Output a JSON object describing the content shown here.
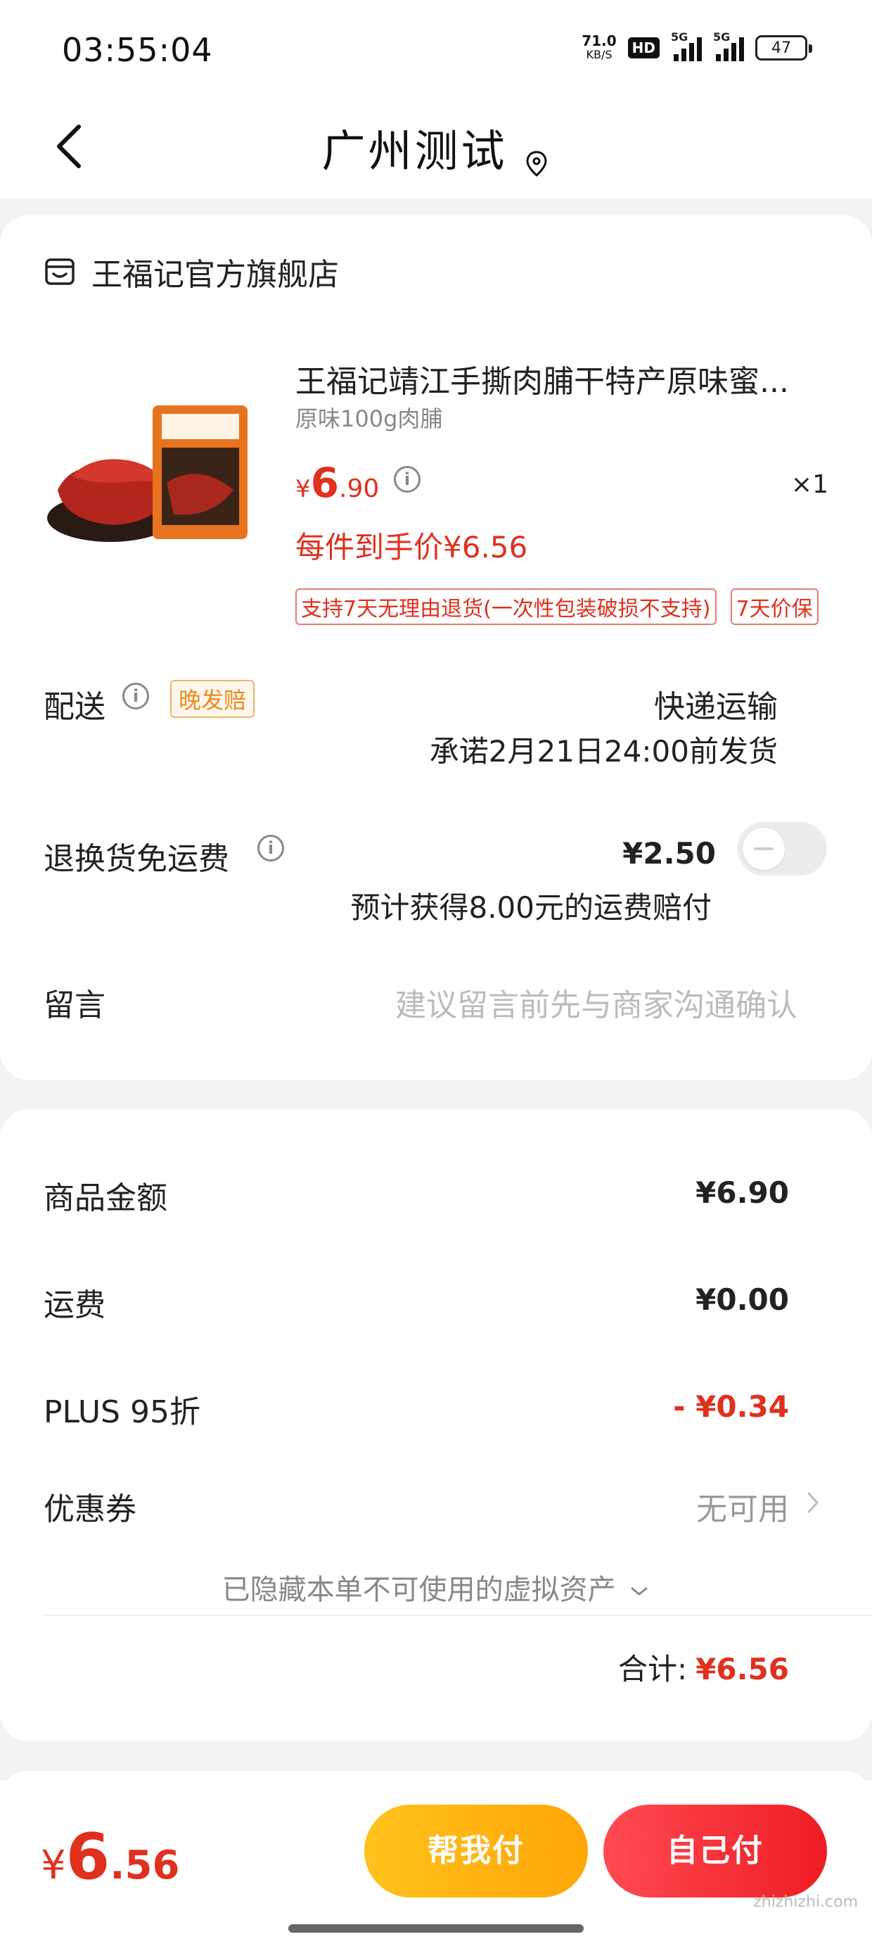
{
  "status_bar": {
    "time": "03:55:04",
    "net_speed_value": "71.0",
    "net_speed_unit": "KB/S",
    "hd_label": "HD",
    "signal1_label": "5G",
    "signal2_label": "5G",
    "battery": "47"
  },
  "header": {
    "title": "广州测试",
    "back_icon": "chevron-left-icon",
    "location_icon": "location-pin-icon"
  },
  "store": {
    "name": "王福记官方旗舰店",
    "icon": "store-icon"
  },
  "product": {
    "title": "王福记靖江手撕肉脯干特产原味蜜...",
    "spec": "原味100g肉脯",
    "price_currency": "¥",
    "price_int": "6",
    "price_dec": ".90",
    "quantity": "×1",
    "deal_price": "每件到手价¥6.56",
    "tags": [
      "支持7天无理由退货(一次性包装破损不支持)",
      "7天价保"
    ]
  },
  "delivery": {
    "label": "配送",
    "badge": "晚发赔",
    "method": "快递运输",
    "promise": "承诺2月21日24:00前发货"
  },
  "return_shipping": {
    "label": "退换货免运费",
    "price": "¥2.50",
    "compensation": "预计获得8.00元的运费赔付",
    "enabled": false
  },
  "message": {
    "label": "留言",
    "placeholder": "建议留言前先与商家沟通确认"
  },
  "fees": {
    "goods_label": "商品金额",
    "goods_value": "¥6.90",
    "shipping_label": "运费",
    "shipping_value": "¥0.00",
    "plus_label": "PLUS 95折",
    "plus_value": "- ¥0.34",
    "coupon_label": "优惠券",
    "coupon_value": "无可用",
    "hidden_assets": "已隐藏本单不可使用的虚拟资产",
    "total_label": "合计:",
    "total_value": "¥6.56"
  },
  "bottom_bar": {
    "currency": "¥",
    "amount_int": "6",
    "amount_dec": ".56",
    "help_pay": "帮我付",
    "self_pay": "自己付"
  },
  "watermark": "zhizhizhi.com",
  "colors": {
    "accent_red": "#e0301e",
    "help_button": "#ffb612",
    "self_button": "#f2262e",
    "late_badge": "#ea8a1e"
  }
}
